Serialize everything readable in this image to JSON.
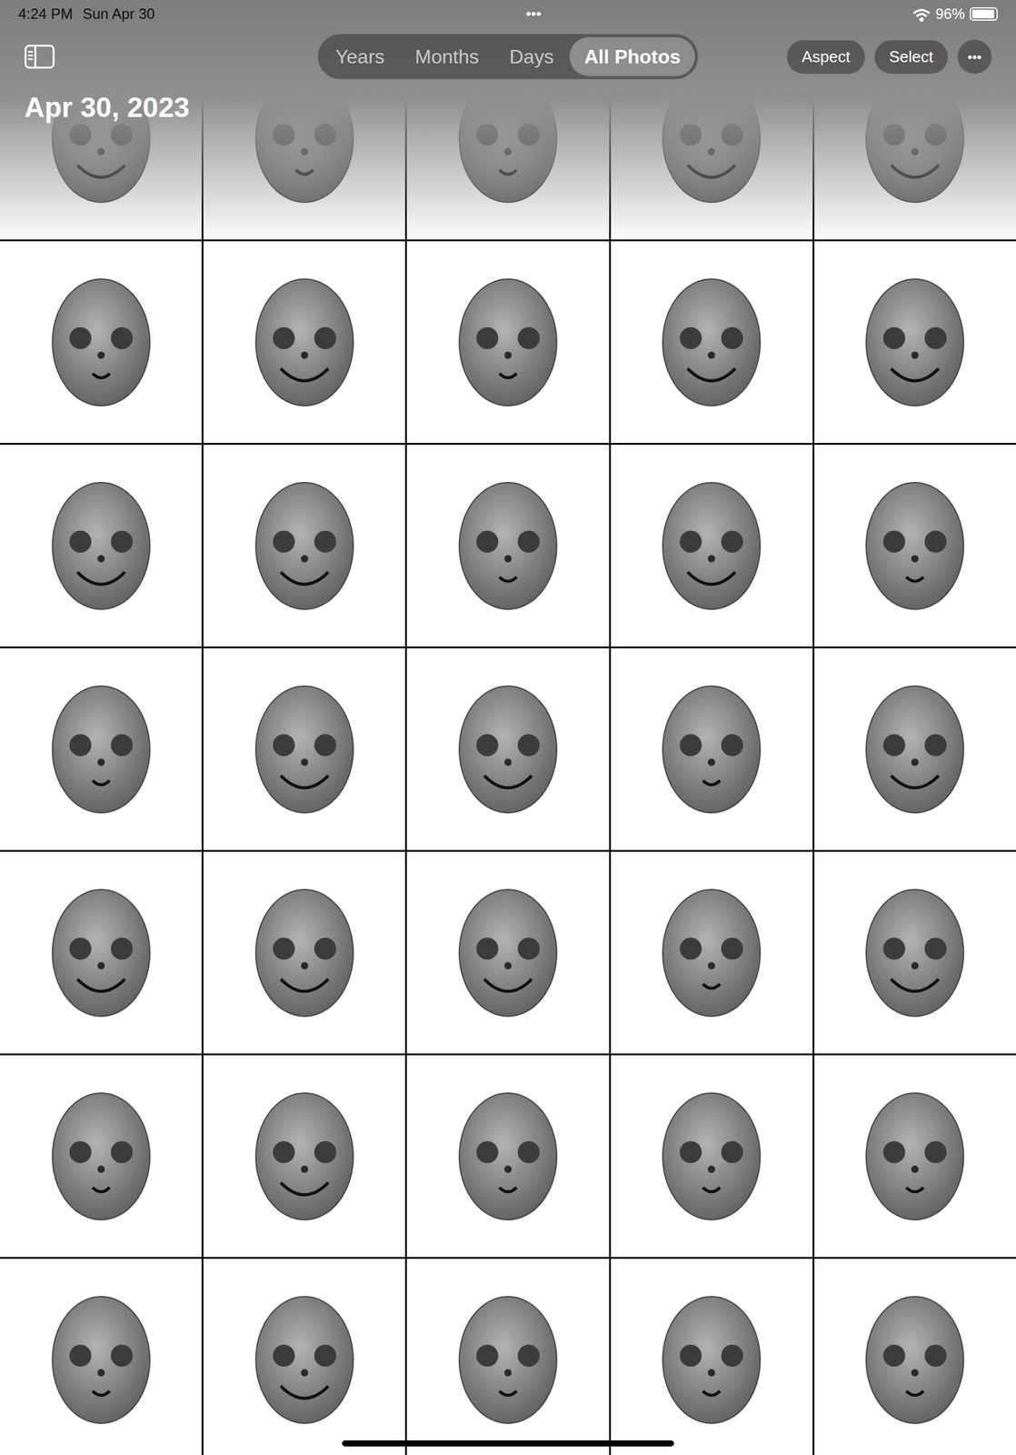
{
  "status_bar": {
    "time": "4:24 PM",
    "date": "Sun Apr 30",
    "handle": "•••",
    "battery": "96%",
    "battery_level": 0.96
  },
  "title": "Apr 30, 2023",
  "tabs": [
    {
      "label": "Years",
      "selected": false
    },
    {
      "label": "Months",
      "selected": false
    },
    {
      "label": "Days",
      "selected": false
    },
    {
      "label": "All Photos",
      "selected": true
    }
  ],
  "buttons": [
    "Aspect",
    "Select"
  ],
  "more": "•••",
  "photos": [
    {
      "kind": "big"
    },
    {
      "kind": "small"
    },
    {
      "kind": "small"
    },
    {
      "kind": "big"
    },
    {
      "kind": "big"
    },
    {
      "kind": "small"
    },
    {
      "kind": "big"
    },
    {
      "kind": "small"
    },
    {
      "kind": "big"
    },
    {
      "kind": "big"
    },
    {
      "kind": "big"
    },
    {
      "kind": "big"
    },
    {
      "kind": "small"
    },
    {
      "kind": "big"
    },
    {
      "kind": "small"
    },
    {
      "kind": "small"
    },
    {
      "kind": "big"
    },
    {
      "kind": "big"
    },
    {
      "kind": "small"
    },
    {
      "kind": "big"
    },
    {
      "kind": "big"
    },
    {
      "kind": "big"
    },
    {
      "kind": "big"
    },
    {
      "kind": "small"
    },
    {
      "kind": "big"
    },
    {
      "kind": "small"
    },
    {
      "kind": "big"
    },
    {
      "kind": "small"
    },
    {
      "kind": "small"
    },
    {
      "kind": "small"
    },
    {
      "kind": "small"
    },
    {
      "kind": "big"
    },
    {
      "kind": "small"
    },
    {
      "kind": "small"
    },
    {
      "kind": "small"
    }
  ]
}
